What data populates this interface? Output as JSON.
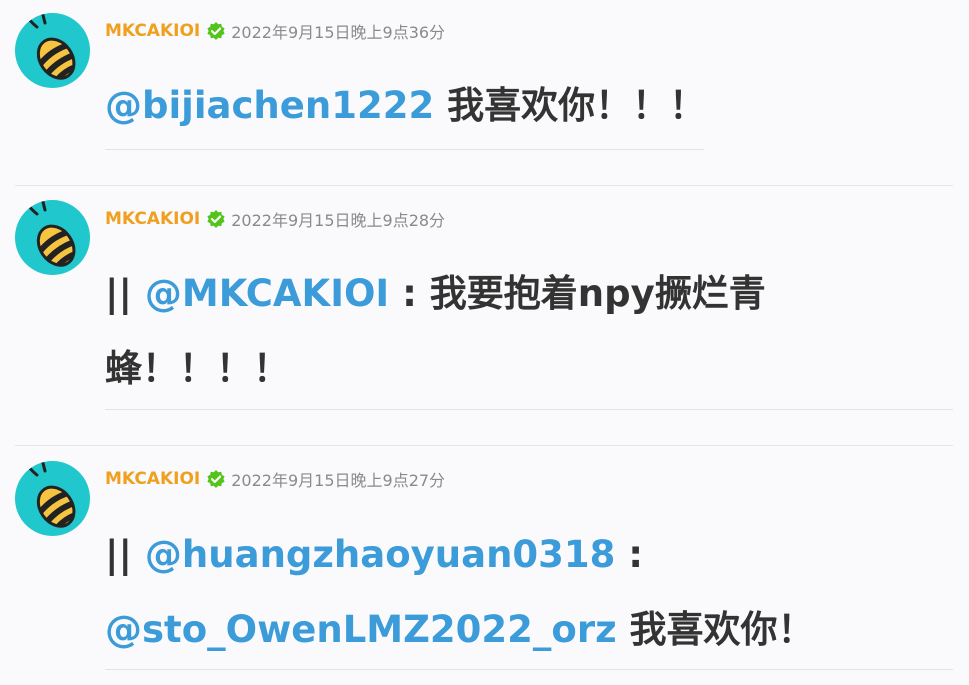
{
  "colors": {
    "username": "#f0a020",
    "mention": "#3c9bd9",
    "text": "#333333",
    "timestamp": "#8a8a8a",
    "verified": "#52c41a",
    "avatar_bg": "#20c7cc"
  },
  "posts": [
    {
      "author": "MKCAKIOI",
      "verified_icon": "verified-check-icon",
      "avatar_icon": "bee-avatar-icon",
      "time": "2022年9月15日晚上9点36分",
      "lines": [
        [
          "@bijiachen1222",
          " 我喜欢你！！！"
        ]
      ]
    },
    {
      "author": "MKCAKIOI",
      "verified_icon": "verified-check-icon",
      "avatar_icon": "bee-avatar-icon",
      "time": "2022年9月15日晚上9点28分",
      "lines": [
        [
          "|| ",
          "@MKCAKIOI",
          " : 我要抱着npy撅烂青"
        ],
        [
          "蜂！！！！"
        ]
      ]
    },
    {
      "author": "MKCAKIOI",
      "verified_icon": "verified-check-icon",
      "avatar_icon": "bee-avatar-icon",
      "time": "2022年9月15日晚上9点27分",
      "lines": [
        [
          "|| ",
          "@huangzhaoyuan0318",
          " :"
        ],
        [
          "@sto_OwenLMZ2022_orz",
          " 我喜欢你！"
        ]
      ]
    }
  ]
}
